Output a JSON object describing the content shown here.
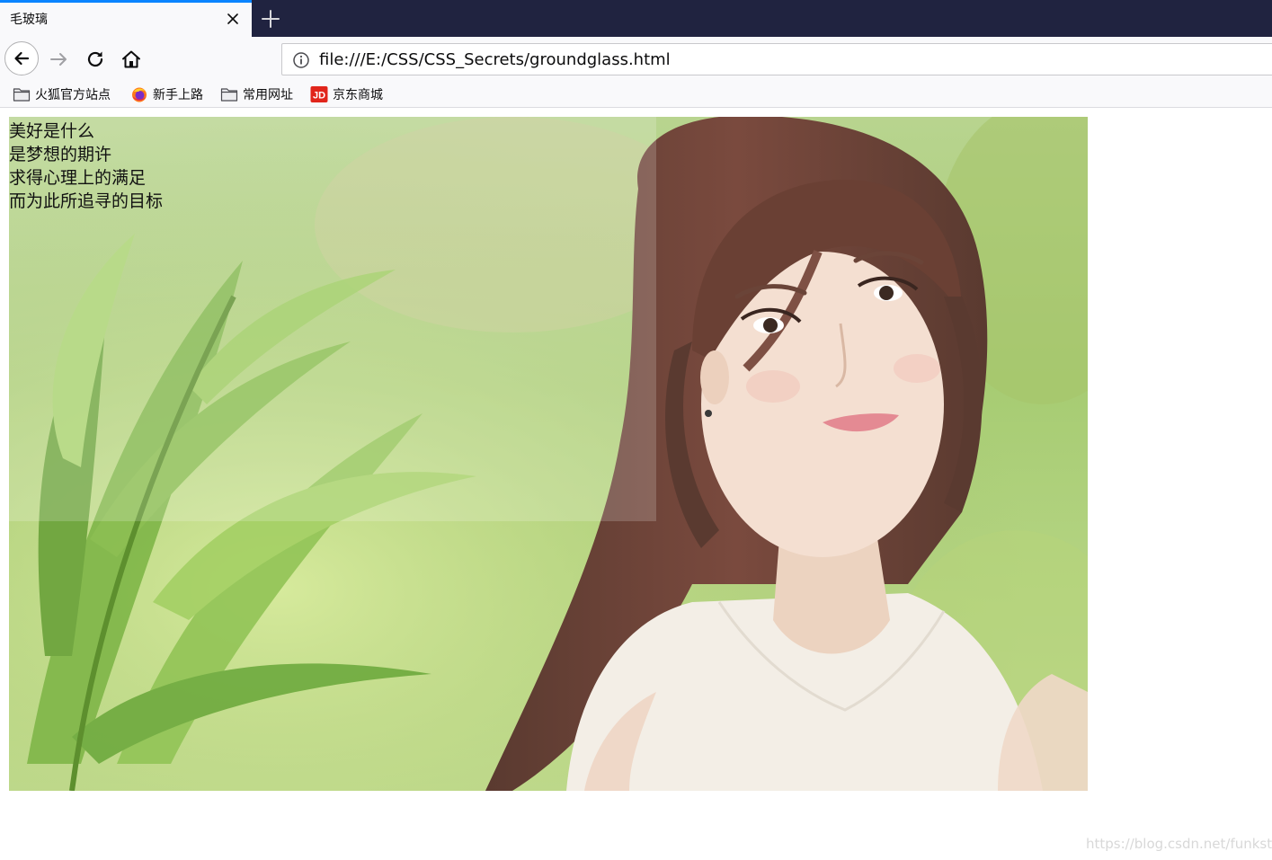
{
  "tab": {
    "title": "毛玻璃"
  },
  "toolbar": {
    "url": "file:///E:/CSS/CSS_Secrets/groundglass.html"
  },
  "bookmarks": [
    {
      "label": "火狐官方站点",
      "icon": "folder-icon"
    },
    {
      "label": "新手上路",
      "icon": "firefox-icon"
    },
    {
      "label": "常用网址",
      "icon": "folder-icon"
    },
    {
      "label": "京东商城",
      "icon": "jd-icon",
      "badge": "JD"
    }
  ],
  "page": {
    "poem": [
      "美好是什么",
      "是梦想的期许",
      "求得心理上的满足",
      "而为此所追寻的目标"
    ],
    "watermark": "https://blog.csdn.net/funkstill"
  },
  "colors": {
    "tabstrip": "#202340",
    "tab_accent": "#0a84ff",
    "toolbar": "#f9f9fb",
    "jd_red": "#e1251b"
  }
}
